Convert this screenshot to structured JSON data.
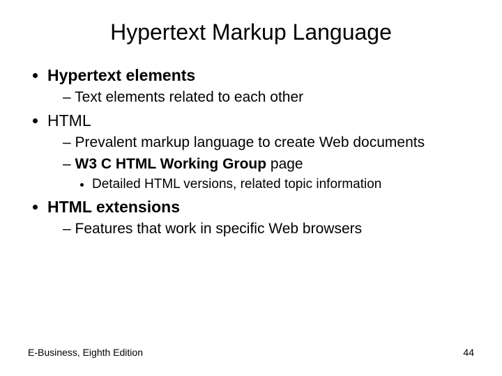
{
  "title": "Hypertext Markup Language",
  "bullets": {
    "b1": "Hypertext elements",
    "b1_1": "Text elements related to each other",
    "b2": "HTML",
    "b2_1": "Prevalent markup language to create Web documents",
    "b2_2_bold": "W3 C HTML Working Group",
    "b2_2_rest": " page",
    "b2_2_1": "Detailed HTML versions, related topic information",
    "b3": "HTML extensions",
    "b3_1": "Features that work in specific Web browsers"
  },
  "footer": {
    "left": "E-Business, Eighth Edition",
    "right": "44"
  }
}
